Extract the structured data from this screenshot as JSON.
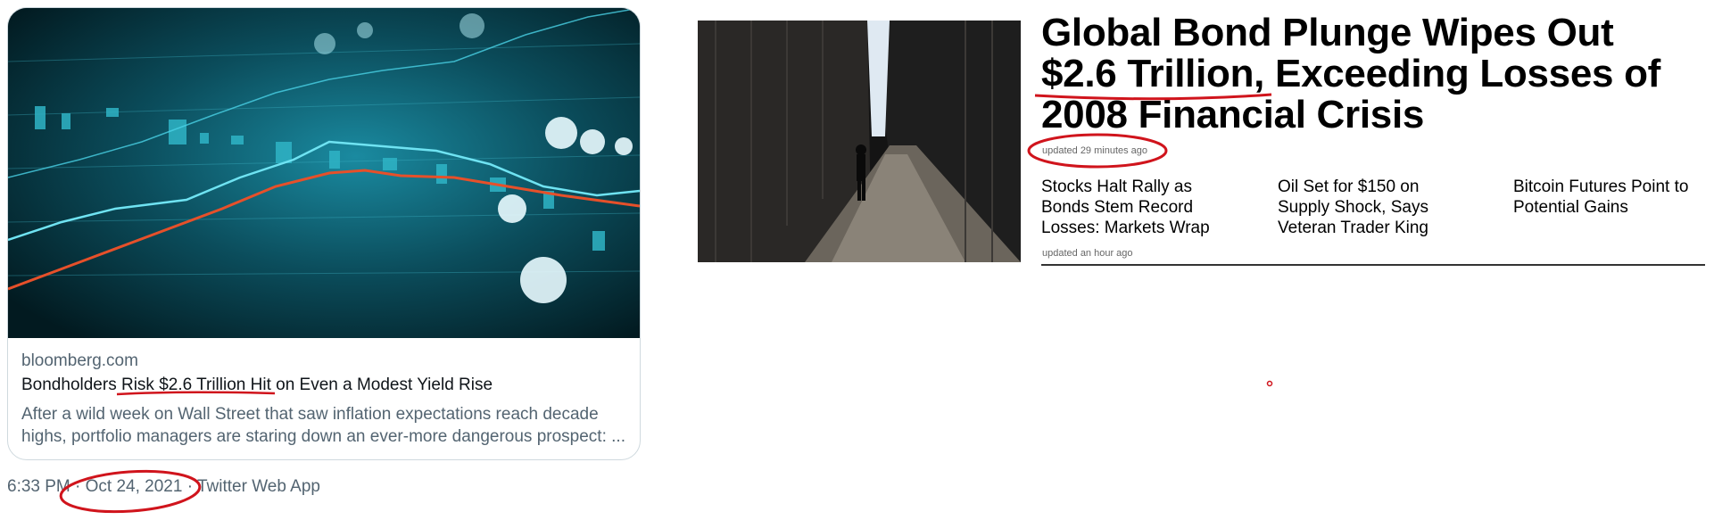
{
  "tweet": {
    "card": {
      "domain": "bloomberg.com",
      "headline": "Bondholders Risk $2.6 Trillion Hit on Even a Modest Yield Rise",
      "description_lines": [
        "After a wild week on Wall Street that saw inflation expectations reach decade",
        "highs, portfolio managers are staring down an ever-more dangerous prospect: ..."
      ]
    },
    "meta": "6:33 PM · Oct 24, 2021 · Twitter Web App"
  },
  "article": {
    "title_lines": [
      "Global Bond Plunge Wipes Out",
      "$2.6 Trillion, Exceeding Losses of",
      "2008 Financial Crisis"
    ],
    "updated": "updated 29 minutes ago",
    "related": [
      {
        "lines": [
          "Stocks Halt Rally as",
          "Bonds Stem Record",
          "Losses: Markets Wrap"
        ]
      },
      {
        "lines": [
          "Oil Set for $150 on",
          "Supply Shock, Says",
          "Veteran Trader King"
        ]
      },
      {
        "lines": [
          "Bitcoin Futures Point to",
          "Potential Gains"
        ]
      }
    ],
    "related_updated": "updated an hour ago"
  },
  "colors": {
    "markup_red": "#d0141c",
    "card_border": "#cfd9de",
    "secondary_text": "#536471"
  }
}
